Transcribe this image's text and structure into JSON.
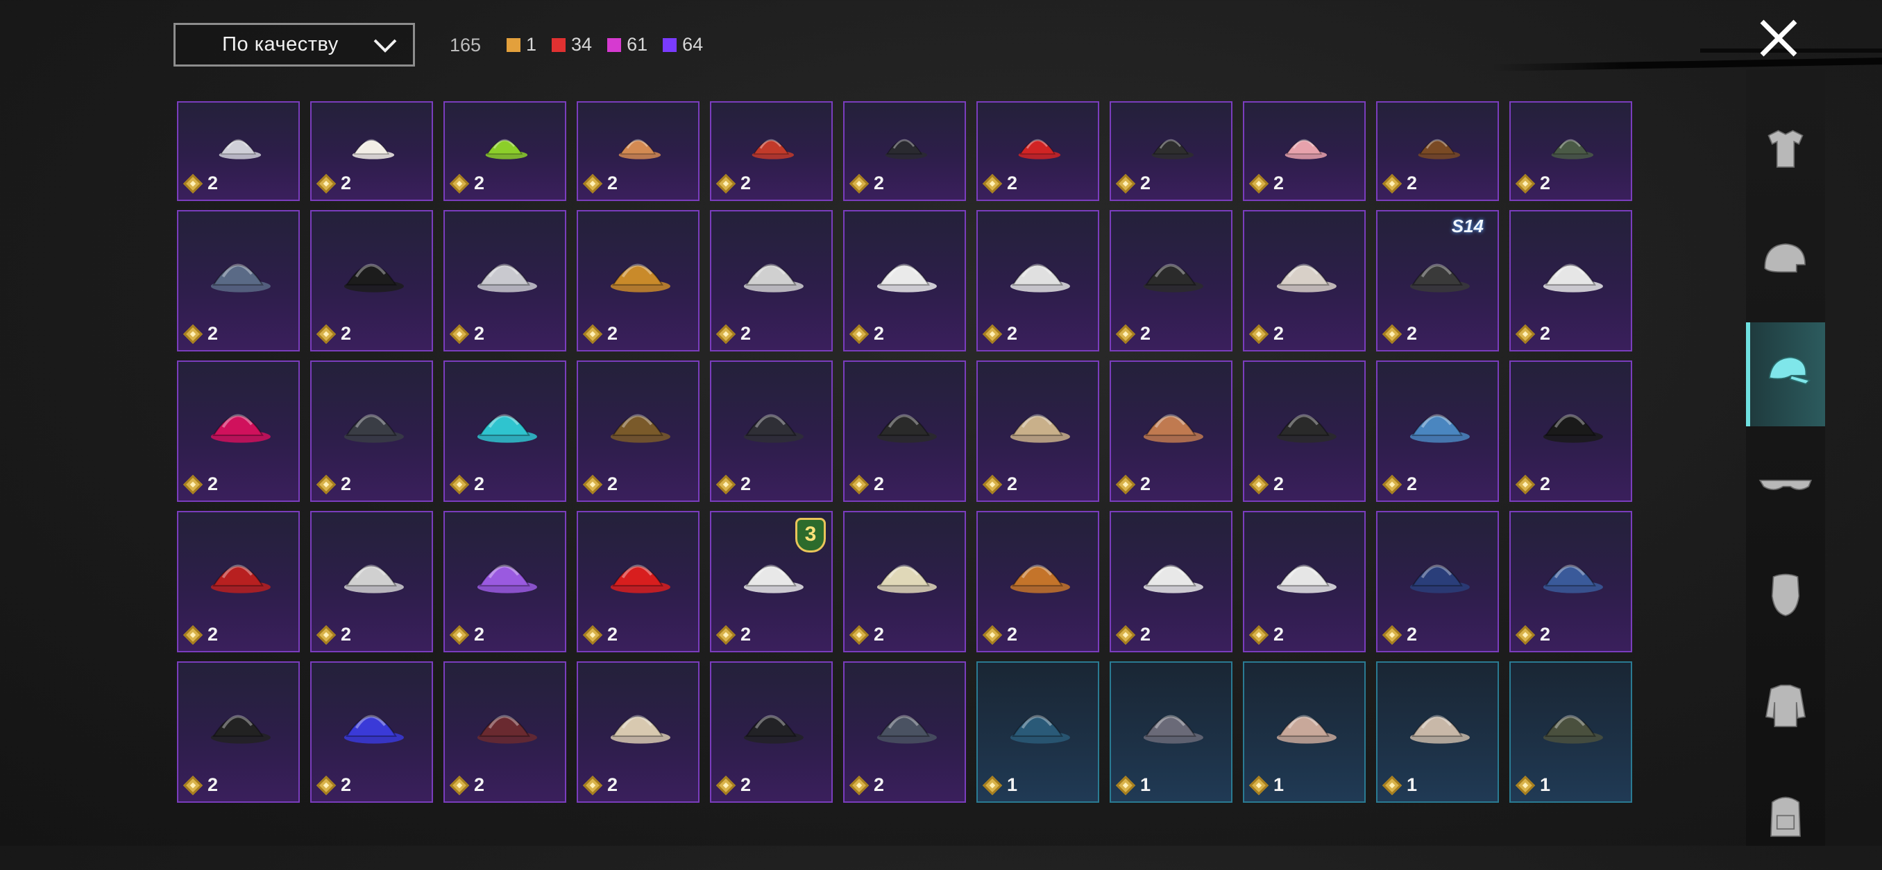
{
  "header": {
    "sort_label": "По качеству",
    "total": "165",
    "legend": [
      {
        "color": "#e3a03c",
        "count": "1"
      },
      {
        "color": "#e03131",
        "count": "34"
      },
      {
        "color": "#d63ad0",
        "count": "61"
      },
      {
        "color": "#7a3bff",
        "count": "64"
      }
    ]
  },
  "grid": {
    "rows": [
      {
        "items": [
          {
            "icon": "hat-with-hair-icon",
            "qty": "2",
            "rarity": "purple"
          },
          {
            "icon": "sun-hat-icon",
            "qty": "2",
            "rarity": "purple"
          },
          {
            "icon": "rasta-helmet-icon",
            "qty": "2",
            "rarity": "purple"
          },
          {
            "icon": "cat-ears-icon",
            "qty": "2",
            "rarity": "purple"
          },
          {
            "icon": "red-gold-cap-icon",
            "qty": "2",
            "rarity": "purple"
          },
          {
            "icon": "witch-hat-icon",
            "qty": "2",
            "rarity": "purple"
          },
          {
            "icon": "red-mohawk-icon",
            "qty": "2",
            "rarity": "purple"
          },
          {
            "icon": "green-cap-icon",
            "qty": "2",
            "rarity": "purple"
          },
          {
            "icon": "pink-braids-icon",
            "qty": "2",
            "rarity": "purple"
          },
          {
            "icon": "brown-hair-icon",
            "qty": "2",
            "rarity": "purple"
          },
          {
            "icon": "military-cap-icon",
            "qty": "2",
            "rarity": "purple"
          }
        ]
      },
      {
        "items": [
          {
            "icon": "blue-cap-icon",
            "qty": "2",
            "rarity": "purple"
          },
          {
            "icon": "gas-mask-icon",
            "qty": "2",
            "rarity": "purple"
          },
          {
            "icon": "goggles-cap-icon",
            "qty": "2",
            "rarity": "purple"
          },
          {
            "icon": "beanie-icon",
            "qty": "2",
            "rarity": "purple"
          },
          {
            "icon": "headband-icon",
            "qty": "2",
            "rarity": "purple"
          },
          {
            "icon": "conical-hat-icon",
            "qty": "2",
            "rarity": "purple"
          },
          {
            "icon": "turban-icon",
            "qty": "2",
            "rarity": "purple"
          },
          {
            "icon": "racing-helmet-icon",
            "qty": "2",
            "rarity": "purple"
          },
          {
            "icon": "mask-hair-icon",
            "qty": "2",
            "rarity": "purple"
          },
          {
            "icon": "knight-helmet-icon",
            "qty": "2",
            "rarity": "purple",
            "badge": "S14"
          },
          {
            "icon": "white-hood-icon",
            "qty": "2",
            "rarity": "purple"
          }
        ]
      },
      {
        "items": [
          {
            "icon": "pink-cap-icon",
            "qty": "2",
            "rarity": "purple"
          },
          {
            "icon": "grey-cap-icon",
            "qty": "2",
            "rarity": "purple"
          },
          {
            "icon": "cyan-wig-icon",
            "qty": "2",
            "rarity": "purple"
          },
          {
            "icon": "officer-hair-icon",
            "qty": "2",
            "rarity": "purple"
          },
          {
            "icon": "black-cap-icon",
            "qty": "2",
            "rarity": "purple"
          },
          {
            "icon": "knit-beanie-icon",
            "qty": "2",
            "rarity": "purple"
          },
          {
            "icon": "pith-helmet-icon",
            "qty": "2",
            "rarity": "purple"
          },
          {
            "icon": "antlers-icon",
            "qty": "2",
            "rarity": "purple"
          },
          {
            "icon": "wrestler-mask-icon",
            "qty": "2",
            "rarity": "purple"
          },
          {
            "icon": "shark-hat-icon",
            "qty": "2",
            "rarity": "purple"
          },
          {
            "icon": "top-hat-icon",
            "qty": "2",
            "rarity": "purple"
          }
        ]
      },
      {
        "items": [
          {
            "icon": "red-fedora-icon",
            "qty": "2",
            "rarity": "purple"
          },
          {
            "icon": "shark-hood-icon",
            "qty": "2",
            "rarity": "purple"
          },
          {
            "icon": "flower-wreath-icon",
            "qty": "2",
            "rarity": "purple"
          },
          {
            "icon": "red-bucket-hat-icon",
            "qty": "2",
            "rarity": "purple"
          },
          {
            "icon": "white-wreath-icon",
            "qty": "2",
            "rarity": "purple",
            "badge": "3"
          },
          {
            "icon": "pudding-hat-icon",
            "qty": "2",
            "rarity": "purple"
          },
          {
            "icon": "burger-hat-icon",
            "qty": "2",
            "rarity": "purple"
          },
          {
            "icon": "head-mirror-icon",
            "qty": "2",
            "rarity": "purple"
          },
          {
            "icon": "white-peaked-cap-icon",
            "qty": "2",
            "rarity": "purple"
          },
          {
            "icon": "blue-peaked-cap-icon",
            "qty": "2",
            "rarity": "purple"
          },
          {
            "icon": "garrison-cap-icon",
            "qty": "2",
            "rarity": "purple"
          }
        ]
      },
      {
        "items": [
          {
            "icon": "black-print-cap-icon",
            "qty": "2",
            "rarity": "purple"
          },
          {
            "icon": "royal-blue-cap-icon",
            "qty": "2",
            "rarity": "purple"
          },
          {
            "icon": "maroon-fedora-icon",
            "qty": "2",
            "rarity": "purple"
          },
          {
            "icon": "parade-cap-icon",
            "qty": "2",
            "rarity": "purple"
          },
          {
            "icon": "black-bucket-hat-icon",
            "qty": "2",
            "rarity": "purple"
          },
          {
            "icon": "aviator-cap-icon",
            "qty": "2",
            "rarity": "purple"
          },
          {
            "icon": "blue-beret-icon",
            "qty": "1",
            "rarity": "blue"
          },
          {
            "icon": "grey-beret-icon",
            "qty": "1",
            "rarity": "blue"
          },
          {
            "icon": "tan-cap-icon",
            "qty": "1",
            "rarity": "blue"
          },
          {
            "icon": "beige-cap-icon",
            "qty": "1",
            "rarity": "blue"
          },
          {
            "icon": "camo-headset-cap-icon",
            "qty": "1",
            "rarity": "blue"
          }
        ]
      }
    ]
  },
  "sidebar": {
    "items": [
      {
        "icon": "outfit-icon",
        "active": false
      },
      {
        "icon": "helmet-icon",
        "active": false
      },
      {
        "icon": "cap-icon",
        "active": true
      },
      {
        "icon": "glasses-icon",
        "active": false
      },
      {
        "icon": "mask-icon",
        "active": false
      },
      {
        "icon": "jacket-icon",
        "active": false
      },
      {
        "icon": "backpack-icon",
        "active": false
      }
    ]
  }
}
